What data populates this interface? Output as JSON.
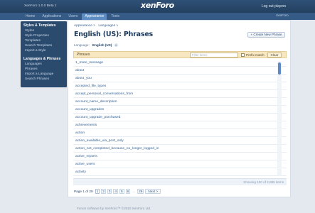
{
  "header": {
    "version": "XenForo 1.0.0 Beta 1",
    "logo": "xenForo",
    "logout": "Log out players",
    "brand_right": "XenForo"
  },
  "nav": {
    "tabs": [
      "Home",
      "Applications",
      "Users",
      "Appearance",
      "Tools"
    ],
    "active_tab": "Appearance"
  },
  "sidebar": {
    "sections": [
      {
        "title": "Styles & Templates",
        "items": [
          "Styles",
          "Style Properties",
          "Templates",
          "Search Templates",
          "Import a Style"
        ]
      },
      {
        "title": "Languages & Phrases",
        "items": [
          "Languages",
          "Phrases",
          "Import a Language",
          "Search Phrases"
        ]
      }
    ]
  },
  "main": {
    "breadcrumb": [
      "Appearance >",
      "Languages >"
    ],
    "title": "English (US): Phrases",
    "create_button": "+ Create New Phrase",
    "language_label": "Language:",
    "language_value": "English (US)",
    "language_remove": "×",
    "filter": {
      "label": "Phrases",
      "placeholder": "Filter items",
      "prefix_label": "Prefix match",
      "clear_label": "Clear"
    },
    "phrases": [
      "1_more_message",
      "about",
      "about_you",
      "accepted_file_types",
      "accept_personal_conversations_from",
      "account_name_description",
      "account_upgrades",
      "account_upgrade_purchased",
      "achievements",
      "action",
      "action_available_via_post_only",
      "action_not_completed_because_no_longer_logged_in",
      "active_reports",
      "active_users",
      "activity"
    ],
    "showing": "Showing 100 of 2,885 items",
    "pagination": {
      "page_of": "Page 1 of 29",
      "pages": [
        "1",
        "2",
        "3",
        "4",
        "5",
        "6"
      ],
      "current": "1",
      "gap": "...",
      "last": "29",
      "next": "Next >"
    }
  },
  "footer": {
    "text": "Forum software by XenForo™ ©2010 XenForo Ltd."
  },
  "colors": {
    "topbar": "#23405f",
    "nav": "#345a85",
    "active_tab": "#5d8dc2",
    "sidebar": "#2a4a6e",
    "filter_bar": "#f7e7c1",
    "link": "#2f5f93"
  }
}
